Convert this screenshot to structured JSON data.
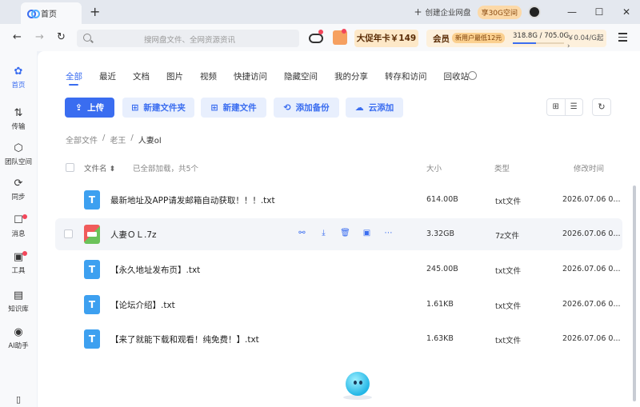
{
  "titlebar": {
    "tab_label": "首页",
    "new_tab_symbol": "+",
    "create_enterprise": "创建企业网盘",
    "space_badge": "享30G空间",
    "window_controls": {
      "minimize": "—",
      "maximize": "☐",
      "close": "✕"
    }
  },
  "toolbar": {
    "search_placeholder": "搜网盘文件、全网资源资讯",
    "promo_label": "大促年卡￥149",
    "vip": {
      "label": "会员",
      "offer": "新用户最低12元",
      "quota": "318.8G / 705.0G",
      "quota_used_fraction": 0.452,
      "price": "￥0.04/G起 ›"
    }
  },
  "leftnav": [
    {
      "label": "首页",
      "icon": "home-icon",
      "active": true
    },
    {
      "label": "传输",
      "icon": "transfer-icon",
      "active": false
    },
    {
      "label": "团队空间",
      "icon": "team-space-icon",
      "active": false
    },
    {
      "label": "同步",
      "icon": "sync-icon",
      "active": false
    },
    {
      "label": "消息",
      "icon": "message-icon",
      "active": false
    },
    {
      "label": "工具",
      "icon": "tools-icon",
      "active": false
    },
    {
      "label": "知识库",
      "icon": "knowledge-base-icon",
      "active": false
    },
    {
      "label": "AI助手",
      "icon": "ai-assistant-icon",
      "active": false
    }
  ],
  "tabs": [
    "全部",
    "最近",
    "文档",
    "图片",
    "视频",
    "快捷访问",
    "隐藏空间",
    "我的分享",
    "转存和访问",
    "回收站"
  ],
  "actions": {
    "upload": "上传",
    "new_folder": "新建文件夹",
    "new_file": "新建文件",
    "add_backup": "添加备份",
    "cloud_add": "云添加"
  },
  "breadcrumb": {
    "root": "全部文件",
    "separator": "/",
    "parent": "老王",
    "current": "人妻ol"
  },
  "list_header": {
    "name": "文件名",
    "sort_arrow": "⬍",
    "loaded_info": "已全部加载，共5个",
    "size": "大小",
    "type": "类型",
    "modified": "修改时间"
  },
  "files": [
    {
      "name": "最新地址及APP请发邮箱自动获取！！！.txt",
      "size": "614.00B",
      "type": "txt文件",
      "modified": "2026.07.06 0...",
      "icon": "T",
      "kind": "txt"
    },
    {
      "name": "人妻ＯＬ.7z",
      "size": "3.32GB",
      "type": "7z文件",
      "modified": "2026.07.06 0...",
      "icon": "",
      "kind": "7z"
    },
    {
      "name": "【永久地址发布页】.txt",
      "size": "245.00B",
      "type": "txt文件",
      "modified": "2026.07.06 0...",
      "icon": "T",
      "kind": "txt"
    },
    {
      "name": "【论坛介绍】.txt",
      "size": "1.61KB",
      "type": "txt文件",
      "modified": "2026.07.06 0...",
      "icon": "T",
      "kind": "txt"
    },
    {
      "name": "【来了就能下载和观看！纯免费！】.txt",
      "size": "1.63KB",
      "type": "txt文件",
      "modified": "2026.07.06 0...",
      "icon": "T",
      "kind": "txt"
    }
  ],
  "row_actions": [
    "share-icon",
    "download-icon",
    "delete-icon",
    "save-icon",
    "more-icon"
  ]
}
